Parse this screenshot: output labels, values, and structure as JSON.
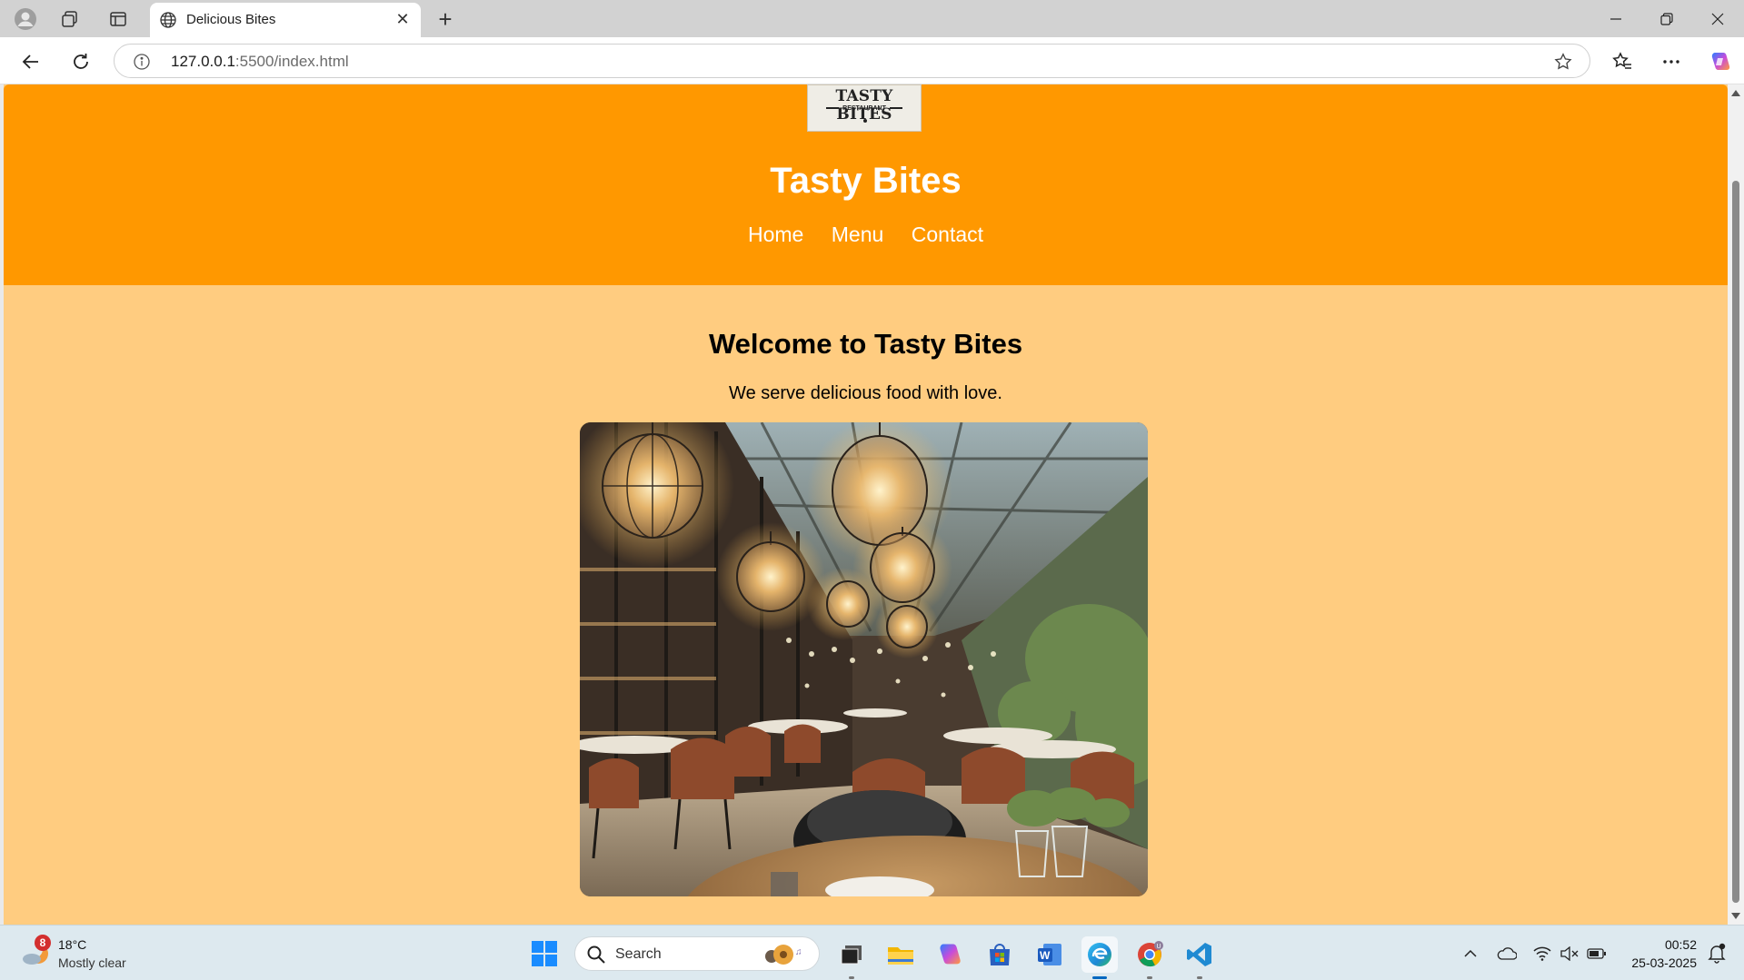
{
  "browser": {
    "tab_title": "Delicious Bites",
    "url_host": "127.0.0.1",
    "url_path": ":5500/index.html"
  },
  "site": {
    "logo": {
      "title": "TASTY BITES",
      "subtitle": "RESTAURANT"
    },
    "title": "Tasty Bites",
    "nav": [
      "Home",
      "Menu",
      "Contact"
    ],
    "welcome_heading": "Welcome to Tasty Bites",
    "tagline": "We serve delicious food with love.",
    "colors": {
      "header": "#ff9800",
      "body": "#ffcc80"
    }
  },
  "taskbar": {
    "weather_badge": "8",
    "temperature": "18°C",
    "weather_desc": "Mostly clear",
    "search_placeholder": "Search",
    "time": "00:52",
    "date": "25-03-2025",
    "apps": [
      "file-manager-icon",
      "file-explorer-icon",
      "copilot-icon",
      "microsoft-store-icon",
      "word-icon",
      "edge-icon",
      "chrome-icon",
      "vscode-icon"
    ]
  }
}
